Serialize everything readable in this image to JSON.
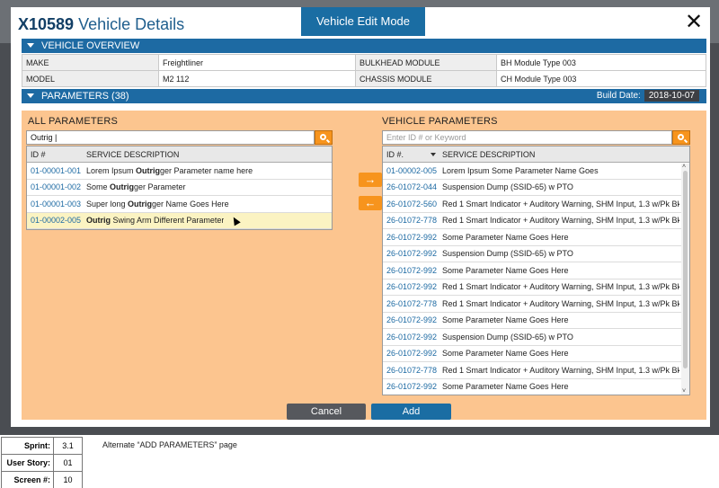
{
  "modal": {
    "id": "X10589",
    "title": "Vehicle Details",
    "mode_tab": "Vehicle Edit Mode",
    "close": "✕"
  },
  "overview": {
    "header": "VEHICLE OVERVIEW",
    "rows": [
      {
        "k1": "MAKE",
        "v1": "Freightliner",
        "k2": "BULKHEAD MODULE",
        "v2": "BH Module Type 003"
      },
      {
        "k1": "MODEL",
        "v1": "M2 112",
        "k2": "CHASSIS MODULE",
        "v2": "CH Module Type 003"
      }
    ]
  },
  "parameters": {
    "header": "PARAMETERS (38)",
    "build_date_label": "Build Date:",
    "build_date": "2018-10-07"
  },
  "all_params": {
    "heading": "ALL PARAMETERS",
    "search_value": "Outrig |",
    "col_id": "ID #",
    "col_desc": "SERVICE DESCRIPTION",
    "rows": [
      {
        "id": "01-00001-001",
        "pre": "Lorem Ipsum ",
        "bold": "Outrig",
        "post": "ger Parameter name here"
      },
      {
        "id": "01-00001-002",
        "pre": "Some ",
        "bold": "Outrig",
        "post": "ger Parameter"
      },
      {
        "id": "01-00001-003",
        "pre": "Super long ",
        "bold": "Outrig",
        "post": "ger Name Goes Here"
      },
      {
        "id": "01-00002-005",
        "pre": "",
        "bold": "Outrig",
        "post": " Swing Arm Different Parameter"
      }
    ]
  },
  "transfer": {
    "add_arrow": "→",
    "remove_arrow": "←"
  },
  "vehicle_params": {
    "heading": "VEHICLE PARAMETERS",
    "search_placeholder": "Enter ID #  or Keyword",
    "col_id": "ID #.",
    "col_desc": "SERVICE DESCRIPTION",
    "rows": [
      {
        "id": "01-00002-005",
        "desc": "Lorem Ipsum Some Parameter Name Goes"
      },
      {
        "id": "26-01072-044",
        "desc": "Suspension Dump (SSID-65) w PTO"
      },
      {
        "id": "26-01072-560",
        "desc": "Red 1 Smart Indicator + Auditory Warning, SHM Input, 1.3 w/Pk Bk..."
      },
      {
        "id": "26-01072-778",
        "desc": "Red 1 Smart Indicator + Auditory Warning, SHM Input, 1.3 w/Pk Bk..."
      },
      {
        "id": "26-01072-992",
        "desc": "Some Parameter Name Goes Here"
      },
      {
        "id": "26-01072-992",
        "desc": "Suspension Dump (SSID-65) w PTO"
      },
      {
        "id": "26-01072-992",
        "desc": "Some Parameter Name Goes Here"
      },
      {
        "id": "26-01072-992",
        "desc": "Red 1 Smart Indicator + Auditory Warning, SHM Input, 1.3 w/Pk Bk..."
      },
      {
        "id": "26-01072-778",
        "desc": "Red 1 Smart Indicator + Auditory Warning, SHM Input, 1.3 w/Pk Bk..."
      },
      {
        "id": "26-01072-992",
        "desc": "Some Parameter Name Goes Here"
      },
      {
        "id": "26-01072-992",
        "desc": "Suspension Dump (SSID-65) w PTO"
      },
      {
        "id": "26-01072-992",
        "desc": "Some Parameter Name Goes Here"
      },
      {
        "id": "26-01072-778",
        "desc": "Red 1 Smart Indicator + Auditory Warning, SHM Input, 1.3 w/Pk Bk..."
      },
      {
        "id": "26-01072-992",
        "desc": "Some Parameter Name Goes Here"
      }
    ]
  },
  "actions": {
    "cancel": "Cancel",
    "add": "Add"
  },
  "footer": {
    "rows": [
      {
        "k": "Sprint:",
        "v": "3.1"
      },
      {
        "k": "User Story:",
        "v": "01"
      },
      {
        "k": "Screen #:",
        "v": "10"
      }
    ],
    "note": "Alternate “ADD PARAMETERS” page"
  },
  "colors": {
    "accent_blue": "#1a6da3",
    "orange_panel": "#fcc58f",
    "orange_button": "#f7941d",
    "selected_row": "#fbf3c2"
  }
}
